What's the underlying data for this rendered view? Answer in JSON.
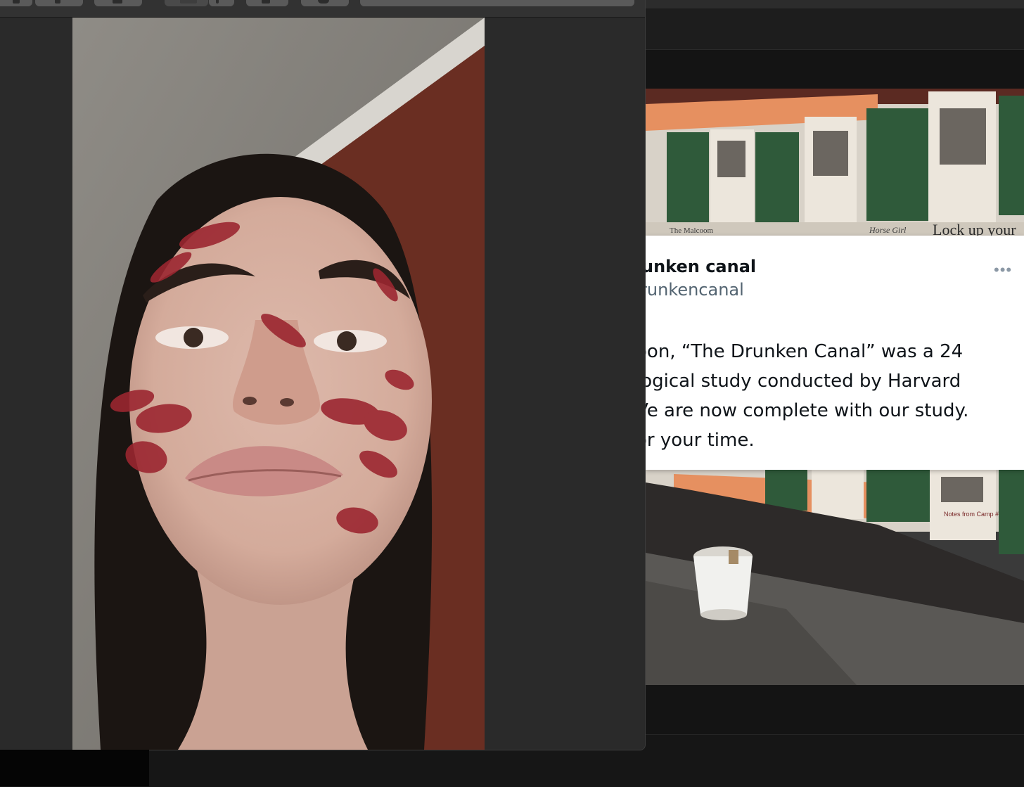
{
  "viewer_window": {
    "toolbar": {
      "buttons": [
        {
          "name": "back-button",
          "icon": "chevron-left-icon"
        },
        {
          "name": "zoom-out-button",
          "icon": "magnifier-icon"
        },
        {
          "name": "share-button",
          "icon": "share-icon"
        },
        {
          "name": "view-mode-button",
          "icon": "sidebar-icon"
        },
        {
          "name": "rotate-button",
          "icon": "rotate-icon"
        },
        {
          "name": "markup-button",
          "icon": "pen-icon"
        },
        {
          "name": "info-button",
          "icon": "info-icon"
        }
      ],
      "search_placeholder": ""
    },
    "image": {
      "subject": "selfie-photo",
      "colors": {
        "wall": "#8a8780",
        "brick": "#6a2e22",
        "hair": "#1b1512",
        "skin": "#d9b3a3",
        "kiss_marks": "#9b2630"
      }
    }
  },
  "tweet_window": {
    "tweet": {
      "display_name": "unken canal",
      "handle": "runkencanal",
      "more_icon": "ellipsis-icon",
      "more_label": "•••",
      "text_lines": [
        "oon, “The Drunken Canal” was a 24",
        "logical study conducted by Harvard",
        "Ve are now complete with our study.",
        "or your time."
      ]
    },
    "photo": {
      "poster_headline": "Lock up your",
      "poster_small_1": "The Malcoom",
      "poster_small_2": "Horse Girl",
      "poster_caption": "Notes from Camp #8",
      "colors": {
        "poster_green": "#2f5a3a",
        "poster_orange": "#e69060",
        "wall": "#2d2a29",
        "ground": "#5a5855",
        "bucket": "#f1f1ee"
      }
    }
  }
}
